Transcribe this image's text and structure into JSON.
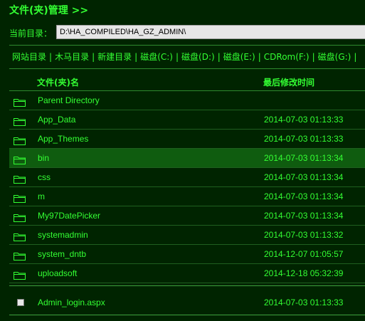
{
  "header": {
    "title": "文件(夹)管理 >>"
  },
  "path_bar": {
    "label": "当前目录：",
    "value": "D:\\HA_COMPILED\\HA_GZ_ADMIN\\"
  },
  "nav": {
    "items": [
      "网站目录",
      "木马目录",
      "新建目录",
      "磁盘(C:)",
      "磁盘(D:)",
      "磁盘(E:)",
      "CDRom(F:)",
      "磁盘(G:)"
    ]
  },
  "table": {
    "columns": [
      "文件(夹)名",
      "最后修改时间"
    ],
    "folders": [
      {
        "name": "Parent Directory",
        "time": ""
      },
      {
        "name": "App_Data",
        "time": "2014-07-03 01:13:33"
      },
      {
        "name": "App_Themes",
        "time": "2014-07-03 01:13:33"
      },
      {
        "name": "bin",
        "time": "2014-07-03 01:13:34"
      },
      {
        "name": "css",
        "time": "2014-07-03 01:13:34"
      },
      {
        "name": "m",
        "time": "2014-07-03 01:13:34"
      },
      {
        "name": "My97DatePicker",
        "time": "2014-07-03 01:13:34"
      },
      {
        "name": "systemadmin",
        "time": "2014-07-03 01:13:32"
      },
      {
        "name": "system_dntb",
        "time": "2014-12-07 01:05:57"
      },
      {
        "name": "uploadsoft",
        "time": "2014-12-18 05:32:39"
      }
    ],
    "files": [
      {
        "name": "Admin_login.aspx",
        "time": "2014-07-03 01:13:33"
      }
    ]
  },
  "colors": {
    "background": "#002400",
    "text": "#33ff33",
    "highlight_row": "#0f5c0f"
  },
  "icons": {
    "folder": "folder-icon",
    "file": "file-icon"
  }
}
